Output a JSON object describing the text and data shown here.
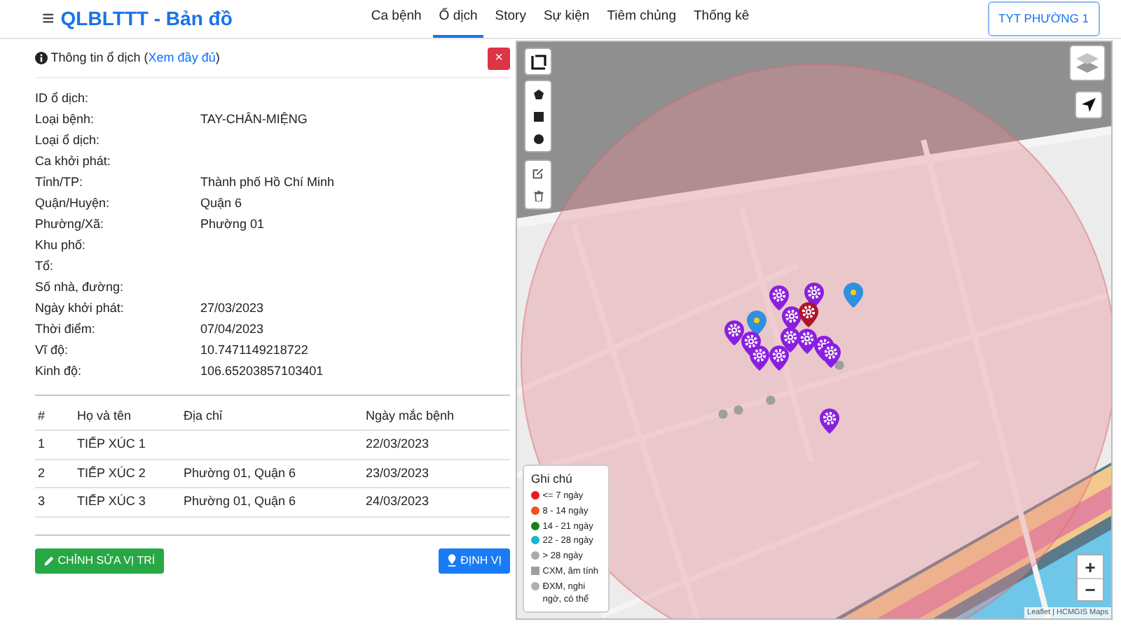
{
  "navbar": {
    "menu": "≡",
    "title": "QLBLTTT - Bản đồ",
    "links": [
      {
        "label": "Ca bệnh",
        "selected": false
      },
      {
        "label": "Ổ dịch",
        "selected": true
      },
      {
        "label": "Story",
        "selected": false
      },
      {
        "label": "Sự kiện",
        "selected": false
      },
      {
        "label": "Tiêm chủng",
        "selected": false
      },
      {
        "label": "Thống kê",
        "selected": false
      }
    ],
    "unit_button": "TYT PHƯỜNG 1"
  },
  "panel": {
    "title_prefix": "Thông tin ổ dịch (",
    "title_link": "Xem đầy đủ",
    "title_suffix": ")",
    "close": "×",
    "fields": [
      {
        "label": "ID ổ dịch:"
      },
      {
        "label": "Loại bệnh:",
        "value": "TAY-CHÂN-MIỆNG"
      },
      {
        "label": "Loại ổ dịch:"
      },
      {
        "label": "Ca khởi phát:"
      },
      {
        "label": "Tỉnh/TP:",
        "value": "Thành phố Hồ Chí Minh"
      },
      {
        "label": "Quận/Huyện:",
        "value": "Quận 6"
      },
      {
        "label": "Phường/Xã:",
        "value": "Phường 01"
      },
      {
        "label": "Khu phố:"
      },
      {
        "label": "Tổ:"
      },
      {
        "label": "Số nhà, đường:"
      },
      {
        "label": "Ngày khởi phát:",
        "value": "27/03/2023"
      },
      {
        "label": "Thời điểm:",
        "value": "07/04/2023"
      },
      {
        "label": "Vĩ độ:",
        "value": "10.7471149218722"
      },
      {
        "label": "Kinh độ:",
        "value": "106.65203857103401"
      }
    ],
    "table": {
      "columns": [
        "#",
        "Họ và tên",
        "Địa chỉ",
        "Ngày mắc bệnh"
      ],
      "rows": [
        [
          "1",
          "TIẾP XÚC 1",
          "",
          "22/03/2023"
        ],
        [
          "2",
          "TIẾP XÚC 2",
          "Phường 01, Quận 6",
          "23/03/2023"
        ],
        [
          "3",
          "TIẾP XÚC 3",
          "Phường 01, Quận 6",
          "24/03/2023"
        ]
      ]
    },
    "edit_button": "CHỈNH SỬA VỊ TRÍ",
    "locate_button": "ĐỊNH VỊ"
  },
  "map": {
    "legend": {
      "title": "Ghi chú",
      "items": [
        {
          "label": "<= 7 ngày",
          "color": "#e41a1c",
          "kind": "dot"
        },
        {
          "label": "8 - 14 ngày",
          "color": "#f4511e",
          "kind": "dot"
        },
        {
          "label": "14 - 21 ngày",
          "color": "#1b7e1b",
          "kind": "dot"
        },
        {
          "label": "22 - 28 ngày",
          "color": "#17b6d4",
          "kind": "dot"
        },
        {
          "label": "> 28 ngày",
          "color": "#aaaaaa",
          "kind": "dot"
        },
        {
          "label": "CXM, âm tính",
          "color": "#9e9e9e",
          "kind": "square"
        },
        {
          "label": "ĐXM, nghi ngờ, có thể",
          "color": "#b0b0b0",
          "kind": "dot"
        }
      ]
    },
    "zoom_in": "+",
    "zoom_out": "−",
    "attribution": "Leaflet | HCMGIS Maps"
  }
}
